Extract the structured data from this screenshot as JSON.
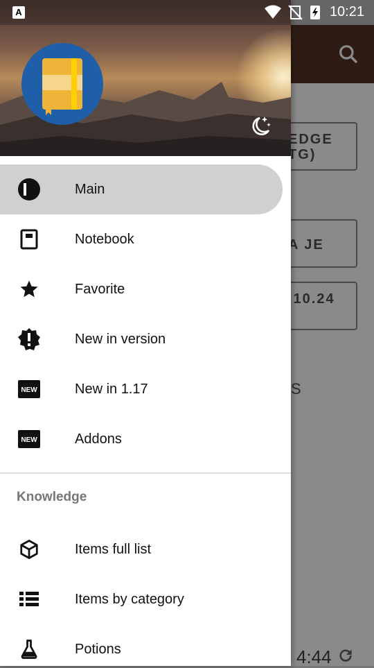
{
  "status_bar": {
    "time": "10:21",
    "left_badge": "A"
  },
  "background_app": {
    "button_1": "EDGE\nTG)",
    "button_2": "A JE",
    "button_3": ".10.24",
    "partial_text": "S",
    "timer": "4:44"
  },
  "drawer": {
    "header": {
      "avatar_icon": "notebook-icon",
      "toggle_icon": "moon-stars-icon"
    },
    "items": [
      {
        "label": "Main",
        "icon": "book-open-icon",
        "active": true
      },
      {
        "label": "Notebook",
        "icon": "notebook-icon"
      },
      {
        "label": "Favorite",
        "icon": "star-icon"
      },
      {
        "label": "New in version",
        "icon": "new-badge-alert-icon"
      },
      {
        "label": "New in 1.17",
        "icon": "new-icon"
      },
      {
        "label": "Addons",
        "icon": "new-icon"
      }
    ],
    "section_title": "Knowledge",
    "knowledge_items": [
      {
        "label": "Items full list",
        "icon": "cube-icon"
      },
      {
        "label": "Items by category",
        "icon": "list-icon"
      },
      {
        "label": "Potions",
        "icon": "flask-icon"
      }
    ]
  },
  "colors": {
    "active_bg": "#d0d0d0",
    "avatar_bg": "#1f5faa",
    "toolbar": "#2e1c14"
  }
}
